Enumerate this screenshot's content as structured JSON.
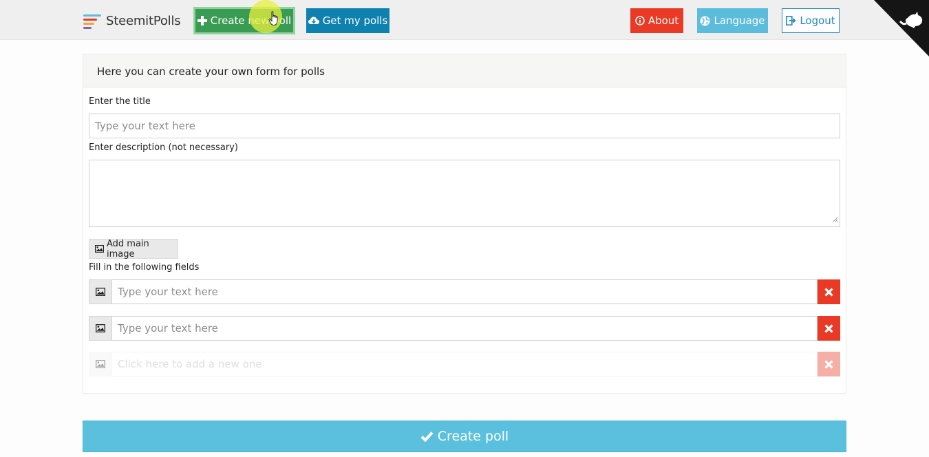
{
  "brand": {
    "name": "SteemitPolls",
    "icon_colors": [
      "#5bbcdc",
      "#ea3a26",
      "#f0a830",
      "#8b5cb6"
    ]
  },
  "nav": {
    "create_label": "Create new poll",
    "get_label": "Get my polls",
    "about_label": "About",
    "language_label": "Language",
    "logout_label": "Logout"
  },
  "panel": {
    "heading": "Here you can create your own form for polls",
    "title_label": "Enter the title",
    "title_placeholder": "Type your text here",
    "desc_label": "Enter description (not necessary)",
    "add_image_label": "Add main image",
    "fields_label": "Fill in the following fields",
    "fields": [
      {
        "placeholder": "Type your text here"
      },
      {
        "placeholder": "Type your text here"
      }
    ],
    "new_field_placeholder": "Click here to add a new one"
  },
  "submit_label": "Create poll",
  "colors": {
    "green": "#3a9b53",
    "blue": "#0f81ae",
    "red": "#ea3a26",
    "light_blue": "#5bbcdc"
  }
}
